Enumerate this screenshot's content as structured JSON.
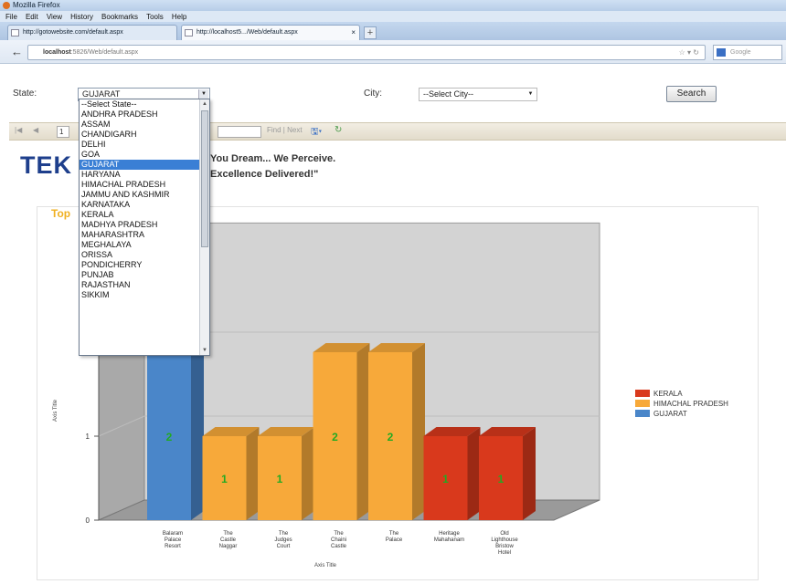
{
  "browser": {
    "window_title": "Mozilla Firefox",
    "menu": [
      "File",
      "Edit",
      "View",
      "History",
      "Bookmarks",
      "Tools",
      "Help"
    ],
    "tabs": [
      {
        "label": "http://gotowebsite.com/default.aspx"
      },
      {
        "label": "http://localhost5.../Web/default.aspx",
        "close": "×"
      }
    ],
    "new_tab": "+",
    "url": {
      "host": "localhost",
      "rest": ":5826/Web/default.aspx"
    },
    "search_placeholder": "Google"
  },
  "form": {
    "state_label": "State:",
    "state_value": "GUJARAT",
    "city_label": "City:",
    "city_value": "--Select City--",
    "search_button": "Search"
  },
  "state_options": [
    "--Select State--",
    "ANDHRA PRADESH",
    "ASSAM",
    "CHANDIGARH",
    "DELHI",
    "GOA",
    "GUJARAT",
    "HARYANA",
    "HIMACHAL PRADESH",
    "JAMMU AND KASHMIR",
    "KARNATAKA",
    "KERALA",
    "MADHYA PRADESH",
    "MAHARASHTRA",
    "MEGHALAYA",
    "ORISSA",
    "PONDICHERRY",
    "PUNJAB",
    "RAJASTHAN",
    "SIKKIM"
  ],
  "selected_state_index": 6,
  "report_toolbar": {
    "first": "|◀",
    "prev": "◀",
    "page": "1",
    "find_next": "Find | Next"
  },
  "header": {
    "brand": "TEK",
    "tagline_1": "You Dream... We Perceive.",
    "tagline_2": "Excellence Delivered!\""
  },
  "report_title": "Top",
  "colors": {
    "kerala": "#d9391c",
    "himachal": "#f7a93a",
    "gujarat": "#4a86c9"
  },
  "chart_data": {
    "type": "bar",
    "categories": [
      "Balaram Palace Resort",
      "The Castle Naggar",
      "The Judges Court",
      "The Chaini Castle",
      "The Palace",
      "Heritage Mahahanam",
      "Old Lighthouse Bristow Hotel"
    ],
    "series": [
      {
        "name": "KERALA",
        "values": [
          null,
          null,
          null,
          null,
          null,
          1,
          1
        ]
      },
      {
        "name": "HIMACHAL PRADESH",
        "values": [
          null,
          1,
          1,
          2,
          2,
          null,
          null
        ]
      },
      {
        "name": "GUJARAT",
        "values": [
          2,
          null,
          null,
          null,
          null,
          null,
          null
        ]
      }
    ],
    "data_labels": [
      "2",
      "1",
      "1",
      "2",
      "2",
      "1",
      "1"
    ],
    "xlabel": "Axis Title",
    "ylabel": "Axis Title",
    "ylim": [
      0,
      2
    ],
    "yticks": [
      "0",
      "1"
    ],
    "legend_position": "right",
    "style": "3d"
  }
}
